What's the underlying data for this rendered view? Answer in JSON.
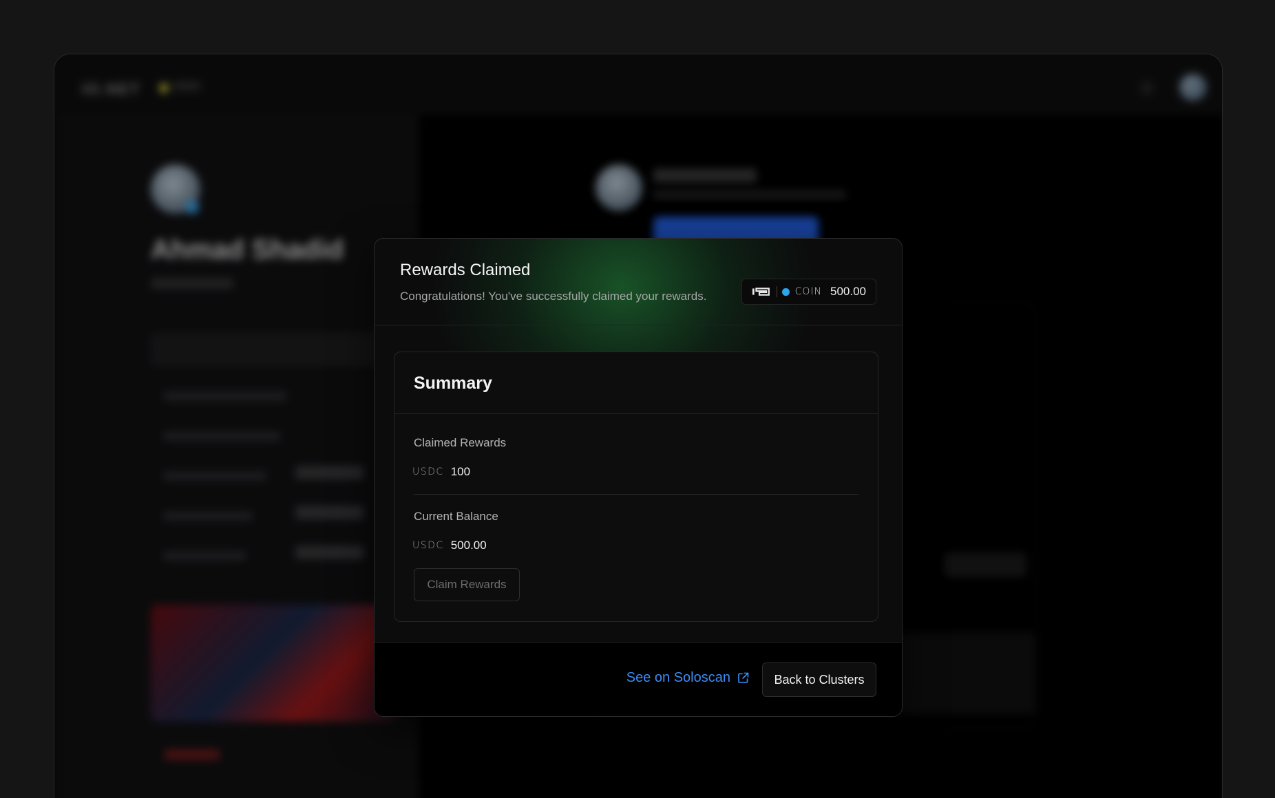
{
  "modal": {
    "title": "Rewards Claimed",
    "subtitle": "Congratulations! You've successfully claimed your rewards.",
    "balance_chip": {
      "logo_icon": "io-logo-icon",
      "currency_label": "COIN",
      "value": "500.00",
      "dot_color": "#2aa7ee"
    }
  },
  "summary": {
    "title": "Summary",
    "claimed": {
      "label": "Claimed Rewards",
      "currency": "USDC",
      "value": "100"
    },
    "balance": {
      "label": "Current Balance",
      "currency": "USDC",
      "value": "500.00"
    },
    "claim_button": "Claim Rewards"
  },
  "footer": {
    "explorer_link": "See on Soloscan",
    "explorer_icon": "external-link-icon",
    "back_button": "Back to Clusters"
  },
  "background": {
    "profile_name": "Ahmad Shadid"
  },
  "colors": {
    "accent_link": "#3d8cf5",
    "glow": "#228c3c",
    "coin_dot": "#2aa7ee"
  }
}
